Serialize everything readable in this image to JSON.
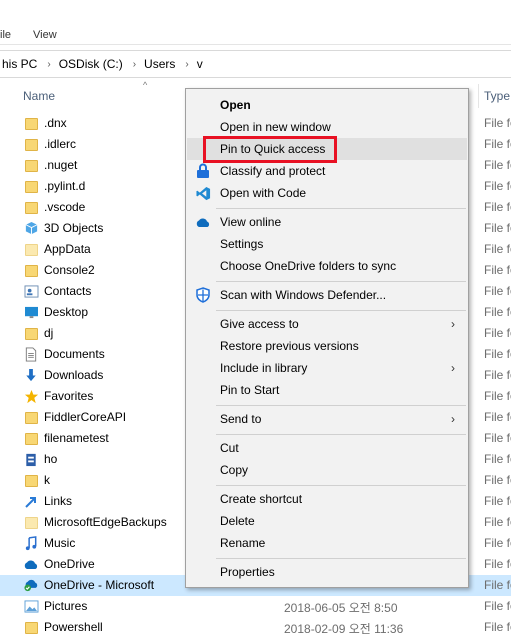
{
  "ribbon": {
    "tab_prev": "ile",
    "tab_view": "View"
  },
  "address": {
    "crumbs": [
      "his PC",
      "OSDisk (C:)",
      "Users",
      "v"
    ],
    "separator": "›"
  },
  "columns": {
    "name": "Name",
    "type": "Type",
    "sort_glyph": "^"
  },
  "files": [
    {
      "name": ".dnx",
      "date": "",
      "type": "File fo",
      "icon": "folder-icon"
    },
    {
      "name": ".idlerc",
      "date": "",
      "type": "File fo",
      "icon": "folder-icon"
    },
    {
      "name": ".nuget",
      "date": "",
      "type": "File fo",
      "icon": "folder-icon"
    },
    {
      "name": ".pylint.d",
      "date": "",
      "type": "File fo",
      "icon": "folder-icon"
    },
    {
      "name": ".vscode",
      "date": "",
      "type": "File fo",
      "icon": "folder-icon"
    },
    {
      "name": "3D Objects",
      "date": "",
      "type": "File fo",
      "icon": "3d-objects-icon"
    },
    {
      "name": "AppData",
      "date": "",
      "type": "File fo",
      "icon": "folder-icon"
    },
    {
      "name": "Console2",
      "date": "",
      "type": "File fo",
      "icon": "folder-icon"
    },
    {
      "name": "Contacts",
      "date": "",
      "type": "File fo",
      "icon": "contacts-icon"
    },
    {
      "name": "Desktop",
      "date": "",
      "type": "File fo",
      "icon": "desktop-icon"
    },
    {
      "name": "dj",
      "date": "",
      "type": "File fo",
      "icon": "folder-icon"
    },
    {
      "name": "Documents",
      "date": "",
      "type": "File fo",
      "icon": "documents-icon"
    },
    {
      "name": "Downloads",
      "date": "",
      "type": "File fo",
      "icon": "downloads-icon"
    },
    {
      "name": "Favorites",
      "date": "",
      "type": "File fo",
      "icon": "favorites-icon"
    },
    {
      "name": "FiddlerCoreAPI",
      "date": "",
      "type": "File fo",
      "icon": "folder-icon"
    },
    {
      "name": "filenametest",
      "date": "",
      "type": "File fo",
      "icon": "folder-icon"
    },
    {
      "name": "ho",
      "date": "",
      "type": "File fo",
      "icon": "ho-icon"
    },
    {
      "name": "k",
      "date": "",
      "type": "File fo",
      "icon": "folder-icon"
    },
    {
      "name": "Links",
      "date": "",
      "type": "File fo",
      "icon": "links-icon"
    },
    {
      "name": "MicrosoftEdgeBackups",
      "date": "",
      "type": "File fo",
      "icon": "folder-icon"
    },
    {
      "name": "Music",
      "date": "",
      "type": "File fo",
      "icon": "music-icon"
    },
    {
      "name": "OneDrive",
      "date": "",
      "type": "File fo",
      "icon": "onedrive-icon"
    },
    {
      "name": "OneDrive - Microsoft",
      "date": "",
      "type": "File fo",
      "icon": "onedrive-sync-icon"
    },
    {
      "name": "Pictures",
      "date": "2018-06-05 오전 8:50",
      "type": "File fo",
      "icon": "pictures-icon"
    },
    {
      "name": "Powershell",
      "date": "2018-02-09 오전 11:36",
      "type": "File fo",
      "icon": "folder-icon"
    }
  ],
  "menu": {
    "open": "Open",
    "open_new_window": "Open in new window",
    "pin_quick_access": "Pin to Quick access",
    "classify": "Classify and protect",
    "open_code": "Open with Code",
    "view_online": "View online",
    "settings": "Settings",
    "choose_folders": "Choose OneDrive folders to sync",
    "scan_defender": "Scan with Windows Defender...",
    "give_access": "Give access to",
    "restore_versions": "Restore previous versions",
    "include_library": "Include in library",
    "pin_start": "Pin to Start",
    "send_to": "Send to",
    "cut": "Cut",
    "copy": "Copy",
    "create_shortcut": "Create shortcut",
    "delete": "Delete",
    "rename": "Rename",
    "properties": "Properties",
    "submenu_arrow": "›"
  },
  "colors": {
    "selection": "#cce8ff",
    "highlight_box": "#e81123",
    "folder": "#f8d774"
  }
}
